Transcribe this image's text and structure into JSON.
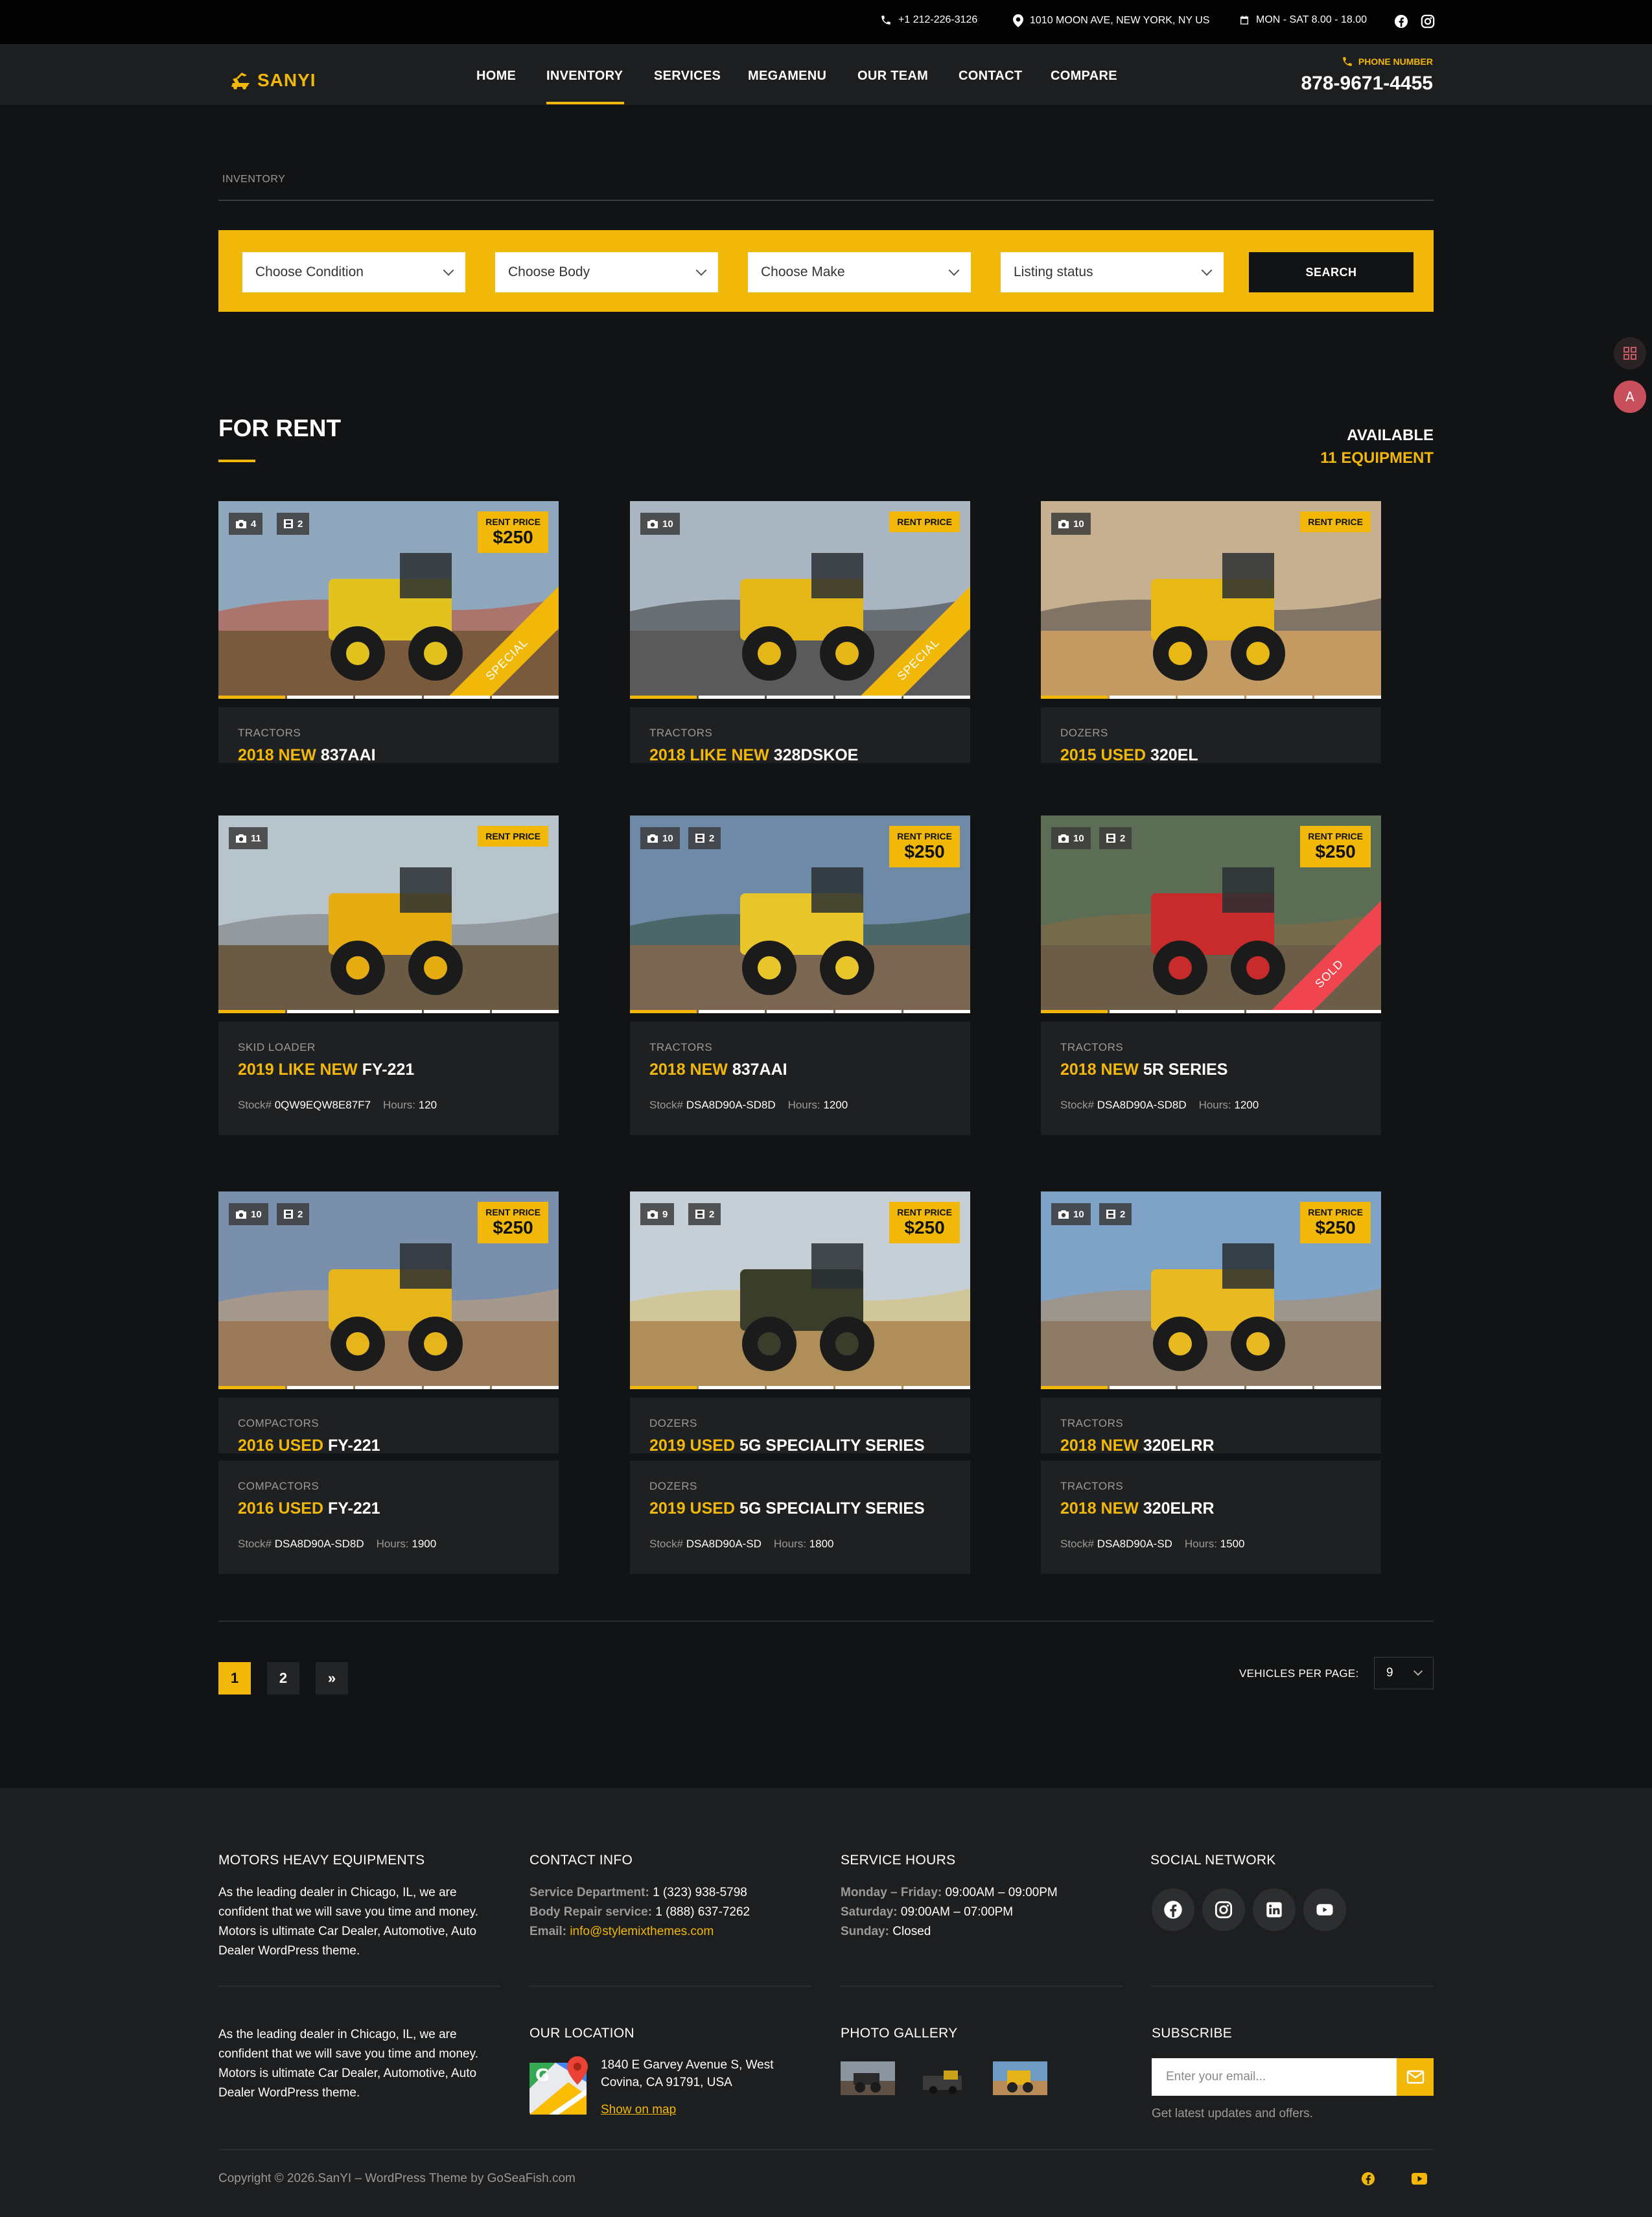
{
  "topbar": {
    "phone": "+1 212-226-3126",
    "address": "1010 MOON AVE, NEW YORK, NY US",
    "hours": "MON - SAT 8.00 - 18.00",
    "social_icons": [
      "facebook-icon",
      "instagram-icon"
    ]
  },
  "header": {
    "logo": "SANYI",
    "menu": [
      "HOME",
      "INVENTORY",
      "SERVICES",
      "MEGAMENU",
      "OUR TEAM",
      "CONTACT",
      "COMPARE"
    ],
    "active_menu": "INVENTORY",
    "phone_label": "PHONE NUMBER",
    "phone_number": "878-9671-4455"
  },
  "breadcrumb": "INVENTORY",
  "filters": {
    "condition": "Choose Condition",
    "body": "Choose Body",
    "make": "Choose Make",
    "status": "Listing status",
    "search_label": "SEARCH"
  },
  "section": {
    "title": "FOR RENT",
    "available_label": "AVAILABLE",
    "available_count": "11 EQUIPMENT"
  },
  "listings": [
    {
      "photos": "4",
      "videos": "2",
      "price_label": "RENT PRICE",
      "price": "$250",
      "ribbon": "SPECIAL",
      "category": "TRACTORS",
      "year_condition": "2018 NEW",
      "model": "837AAI",
      "stock": "",
      "hours": ""
    },
    {
      "photos": "10",
      "videos": "",
      "price_label": "RENT PRICE",
      "price": "",
      "ribbon": "SPECIAL",
      "category": "TRACTORS",
      "year_condition": "2018 LIKE NEW",
      "model": "328DSKOE",
      "stock": "",
      "hours": ""
    },
    {
      "photos": "10",
      "videos": "",
      "price_label": "RENT PRICE",
      "price": "",
      "ribbon": "",
      "category": "DOZERS",
      "year_condition": "2015 USED",
      "model": "320EL",
      "stock": "",
      "hours": ""
    },
    {
      "photos": "11",
      "videos": "",
      "price_label": "RENT PRICE",
      "price": "",
      "ribbon": "",
      "category": "SKID LOADER",
      "year_condition": "2019 LIKE NEW",
      "model": "FY-221",
      "stock": "0QW9EQW8E87F7",
      "hours": "120"
    },
    {
      "photos": "10",
      "videos": "2",
      "price_label": "RENT PRICE",
      "price": "$250",
      "ribbon": "",
      "category": "TRACTORS",
      "year_condition": "2018 NEW",
      "model": "837AAI",
      "stock": "DSA8D90A-SD8D",
      "hours": "1200"
    },
    {
      "photos": "10",
      "videos": "2",
      "price_label": "RENT PRICE",
      "price": "$250",
      "ribbon": "SOLD",
      "category": "TRACTORS",
      "year_condition": "2018 NEW",
      "model": "5R SERIES",
      "stock": "DSA8D90A-SD8D",
      "hours": "1200"
    },
    {
      "photos": "10",
      "videos": "2",
      "price_label": "RENT PRICE",
      "price": "$250",
      "ribbon": "",
      "category": "COMPACTORS",
      "year_condition": "2016 USED",
      "model": "FY-221",
      "stock": "DSA8D90A-SD8D",
      "hours": "1900"
    },
    {
      "photos": "9",
      "videos": "2",
      "price_label": "RENT PRICE",
      "price": "$250",
      "ribbon": "",
      "category": "DOZERS",
      "year_condition": "2019 USED",
      "model": "5G SPECIALITY SERIES",
      "stock": "DSA8D90A-SD",
      "hours": "1800"
    },
    {
      "photos": "10",
      "videos": "2",
      "price_label": "RENT PRICE",
      "price": "$250",
      "ribbon": "",
      "category": "TRACTORS",
      "year_condition": "2018 NEW",
      "model": "320ELRR",
      "stock": "DSA8D90A-SD",
      "hours": "1500"
    }
  ],
  "labels": {
    "stock": "Stock#",
    "hours": "Hours:"
  },
  "pagination": {
    "pages": [
      "1",
      "2"
    ],
    "current": "1",
    "next": "»",
    "per_page_label": "VEHICLES PER PAGE:",
    "per_page": "9"
  },
  "footer": {
    "about_title": "MOTORS HEAVY EQUIPMENTS",
    "about_text": "As the leading dealer in Chicago, IL, we are confident that we will save you time and money. Motors is ultimate Car Dealer, Automotive, Auto Dealer WordPress theme.",
    "contact_title": "CONTACT INFO",
    "contact": [
      {
        "label": "Service Department:",
        "value": "1 (323) 938-5798"
      },
      {
        "label": "Body Repair service:",
        "value": "1 (888) 637-7262"
      },
      {
        "label": "Email:",
        "value": "info@stylemixthemes.com"
      }
    ],
    "hours_title": "SERVICE HOURS",
    "hours": [
      {
        "label": "Monday – Friday:",
        "value": "09:00AM – 09:00PM"
      },
      {
        "label": "Saturday:",
        "value": "09:00AM – 07:00PM"
      },
      {
        "label": "Sunday:",
        "value": "Closed"
      }
    ],
    "social_title": "SOCIAL NETWORK",
    "social_icons": [
      "facebook-icon",
      "instagram-icon",
      "linkedin-icon",
      "youtube-icon"
    ],
    "about_text_2": "As the leading dealer in Chicago, IL, we are confident that we will save you time and money. Motors is ultimate Car Dealer, Automotive, Auto Dealer WordPress theme.",
    "location_title": "OUR LOCATION",
    "location_address": "1840 E Garvey Avenue S, West Covina, CA 91791, USA",
    "location_link": "Show on map",
    "gallery_title": "PHOTO GALLERY",
    "subscribe_title": "SUBSCRIBE",
    "subscribe_placeholder": "Enter your email...",
    "subscribe_note": "Get latest updates and offers.",
    "copyright": "Copyright © 2026.SanYI – WordPress Theme by GoSeaFish.com"
  },
  "colors": {
    "accent": "#f1b80a",
    "background": "#121314",
    "card": "#1f2021",
    "sold": "#f0454f"
  }
}
